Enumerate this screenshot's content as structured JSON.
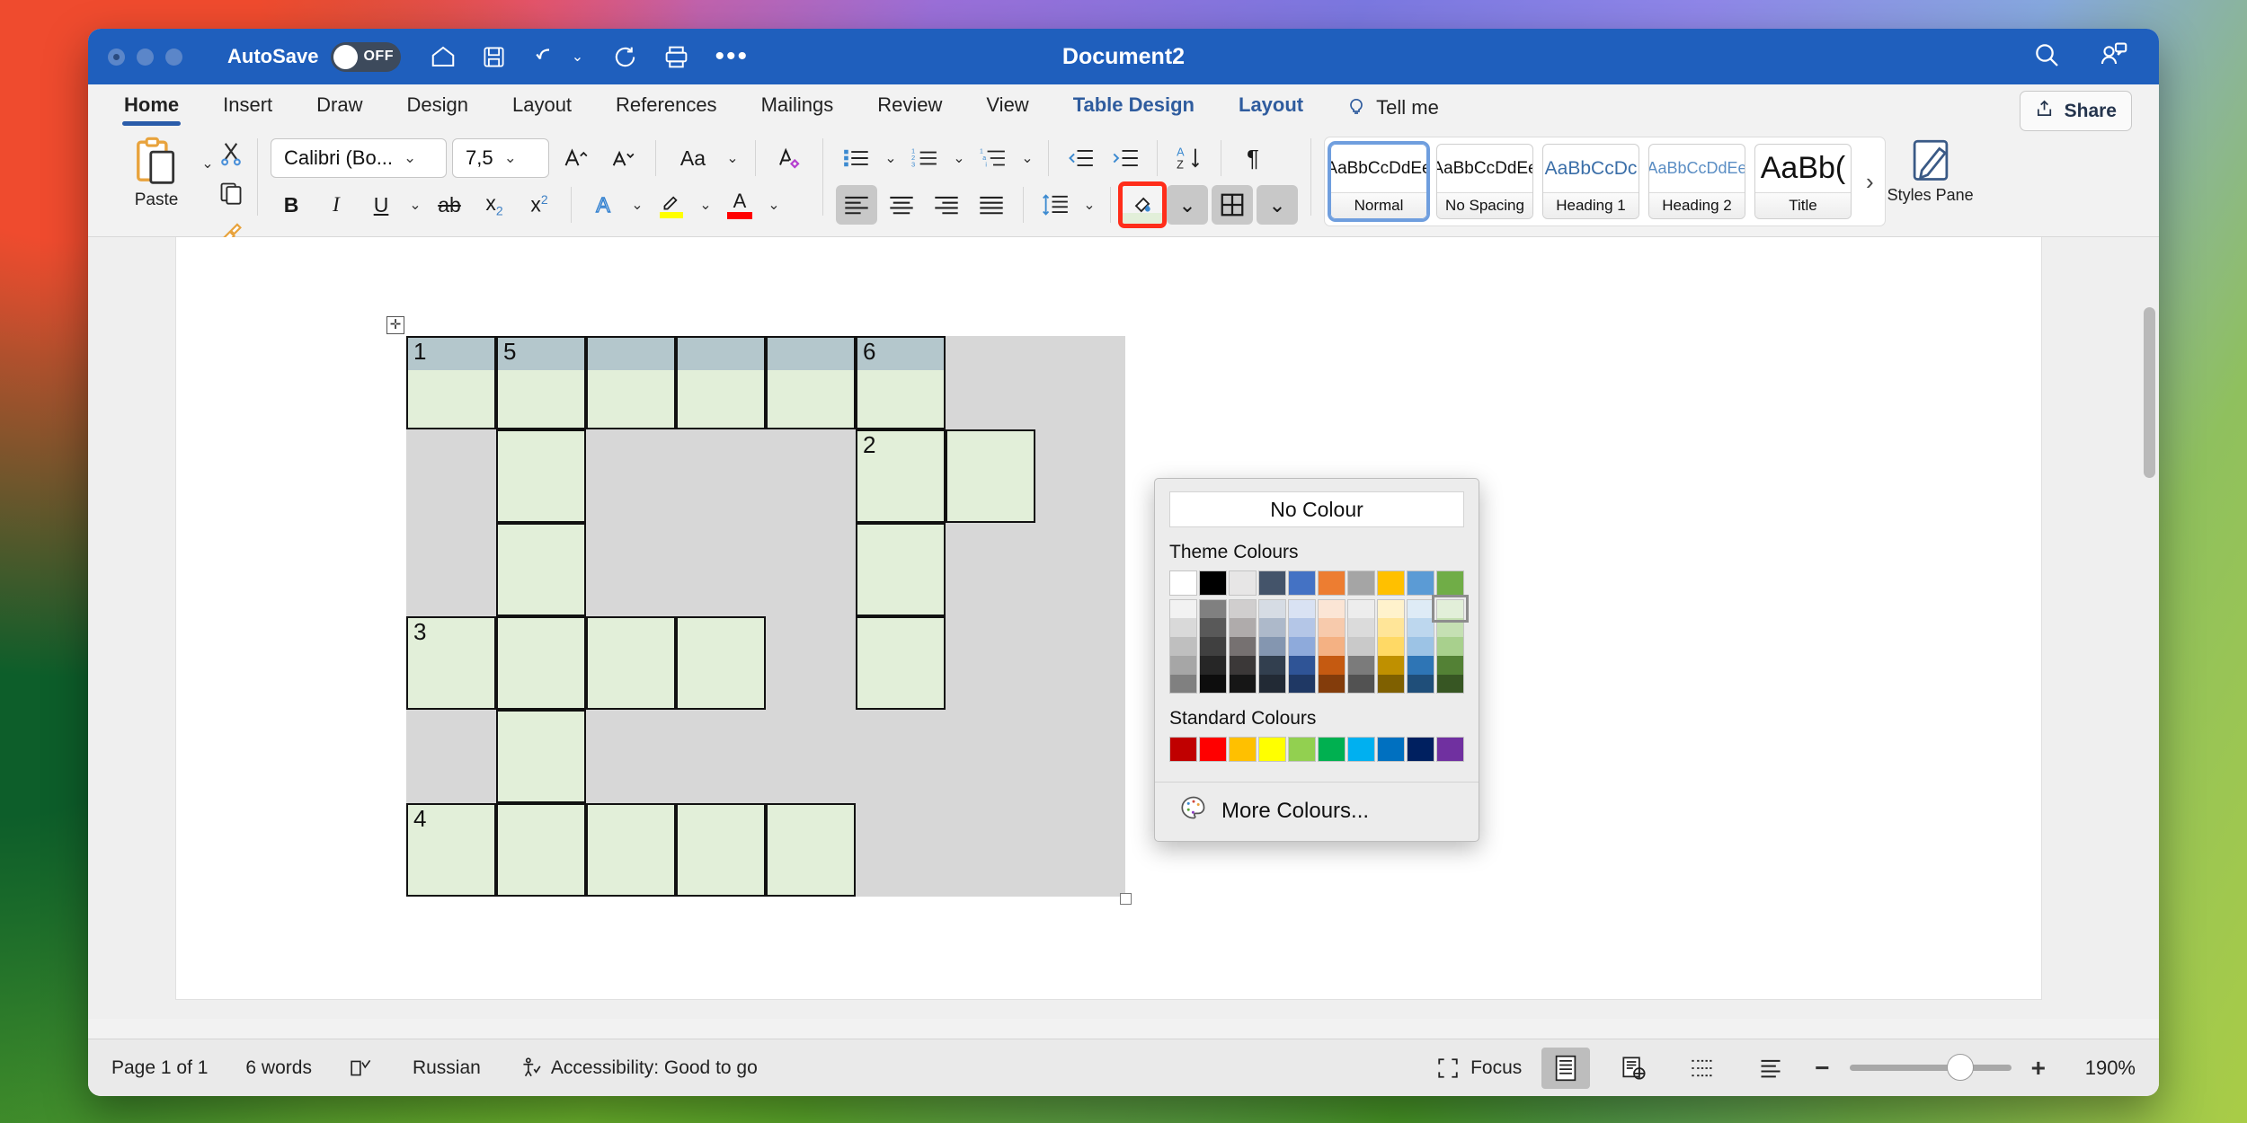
{
  "titlebar": {
    "autosave_label": "AutoSave",
    "autosave_state": "OFF",
    "document_title": "Document2",
    "icons": [
      "home-icon",
      "save-icon",
      "undo-icon",
      "redo-icon",
      "print-icon",
      "more-icon"
    ],
    "right_icons": [
      "search-icon",
      "collaborators-icon"
    ]
  },
  "tabs": [
    {
      "label": "Home",
      "active": true,
      "contextual": false
    },
    {
      "label": "Insert",
      "active": false,
      "contextual": false
    },
    {
      "label": "Draw",
      "active": false,
      "contextual": false
    },
    {
      "label": "Design",
      "active": false,
      "contextual": false
    },
    {
      "label": "Layout",
      "active": false,
      "contextual": false
    },
    {
      "label": "References",
      "active": false,
      "contextual": false
    },
    {
      "label": "Mailings",
      "active": false,
      "contextual": false
    },
    {
      "label": "Review",
      "active": false,
      "contextual": false
    },
    {
      "label": "View",
      "active": false,
      "contextual": false
    },
    {
      "label": "Table Design",
      "active": false,
      "contextual": true
    },
    {
      "label": "Layout",
      "active": false,
      "contextual": true
    }
  ],
  "tellme": "Tell me",
  "share_button": "Share",
  "ribbon": {
    "paste_label": "Paste",
    "font_name": "Calibri (Bo...",
    "font_size": "7,5",
    "styles": [
      {
        "preview": "AaBbCcDdEe",
        "name": "Normal",
        "selected": true,
        "color": "#111111",
        "size": "19px"
      },
      {
        "preview": "AaBbCcDdEe",
        "name": "No Spacing",
        "selected": false,
        "color": "#111111",
        "size": "19px"
      },
      {
        "preview": "AaBbCcDc",
        "name": "Heading 1",
        "selected": false,
        "color": "#3a6ea8",
        "size": "21px"
      },
      {
        "preview": "AaBbCcDdEe",
        "name": "Heading 2",
        "selected": false,
        "color": "#5b8ec4",
        "size": "18px"
      },
      {
        "preview": "AaBb(",
        "name": "Title",
        "selected": false,
        "color": "#111111",
        "size": "34px"
      }
    ],
    "styles_pane_label": "Styles Pane",
    "gallery_next": "›"
  },
  "colour_panel": {
    "no_colour_label": "No Colour",
    "theme_label": "Theme Colours",
    "standard_label": "Standard Colours",
    "more_label": "More Colours...",
    "theme_base": [
      "#ffffff",
      "#000000",
      "#e7e6e6",
      "#44546a",
      "#4472c4",
      "#ed7d31",
      "#a5a5a5",
      "#ffc000",
      "#5b9bd5",
      "#70ad47"
    ],
    "theme_shades": [
      [
        "#f2f2f2",
        "#d9d9d9",
        "#bfbfbf",
        "#a6a6a6",
        "#808080"
      ],
      [
        "#808080",
        "#595959",
        "#404040",
        "#262626",
        "#0d0d0d"
      ],
      [
        "#d0cece",
        "#afabab",
        "#767171",
        "#3b3838",
        "#161616"
      ],
      [
        "#d6dce4",
        "#adb9ca",
        "#8496b0",
        "#323f4f",
        "#222a35"
      ],
      [
        "#d9e2f3",
        "#b4c6e7",
        "#8eaadb",
        "#2f5496",
        "#1f3864"
      ],
      [
        "#fbe5d5",
        "#f7caac",
        "#f4b183",
        "#c55a11",
        "#833c0b"
      ],
      [
        "#ededed",
        "#dbdbdb",
        "#c9c9c9",
        "#7b7b7b",
        "#525252"
      ],
      [
        "#fff2cc",
        "#ffe598",
        "#ffd965",
        "#bf9000",
        "#7f6000"
      ],
      [
        "#deebf6",
        "#bdd7ee",
        "#9cc3e5",
        "#2e75b5",
        "#1f4e79"
      ],
      [
        "#e2efd9",
        "#c5e0b3",
        "#a8d08d",
        "#538135",
        "#375623"
      ]
    ],
    "selected_swatch": {
      "row": 0,
      "col": 9,
      "hex": "#e2efd9"
    },
    "standard": [
      "#c00000",
      "#ff0000",
      "#ffc000",
      "#ffff00",
      "#92d050",
      "#00b050",
      "#00b0f0",
      "#0070c0",
      "#002060",
      "#7030a0"
    ]
  },
  "document": {
    "table_numbers": [
      {
        "n": "1",
        "col": 0,
        "row": 0
      },
      {
        "n": "5",
        "col": 1,
        "row": 0
      },
      {
        "n": "6",
        "col": 5,
        "row": 0
      },
      {
        "n": "2",
        "col": 5,
        "row": 1
      },
      {
        "n": "3",
        "col": 0,
        "row": 3
      },
      {
        "n": "4",
        "col": 0,
        "row": 5
      }
    ],
    "grid_cols": 8,
    "grid_rows": 6,
    "cell_fill_green": "#e2efd9",
    "cell_fill_header": "#b4c7cc",
    "cell_fill_empty": "#d7d7d7",
    "filled_cells": [
      [
        1,
        1,
        1,
        1,
        1,
        1,
        0,
        0
      ],
      [
        0,
        1,
        0,
        0,
        0,
        1,
        1,
        0
      ],
      [
        0,
        1,
        0,
        0,
        0,
        1,
        0,
        0
      ],
      [
        1,
        1,
        1,
        1,
        0,
        1,
        0,
        0
      ],
      [
        0,
        1,
        0,
        0,
        0,
        0,
        0,
        0
      ],
      [
        1,
        1,
        1,
        1,
        1,
        0,
        0,
        0
      ]
    ],
    "header_cells": [
      1,
      1,
      1,
      1,
      1,
      1,
      0,
      0
    ]
  },
  "status": {
    "page": "Page 1 of 1",
    "words": "6 words",
    "language": "Russian",
    "accessibility": "Accessibility: Good to go",
    "focus": "Focus",
    "zoom": "190%"
  }
}
